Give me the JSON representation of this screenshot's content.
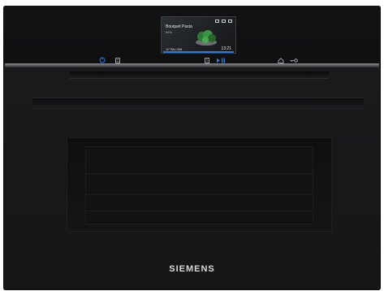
{
  "image": {
    "subject": "built-in compact oven"
  },
  "display": {
    "title": "Bouquet Pasta",
    "subtitle": "96%",
    "left_text": "11°/Mo.368",
    "time": "13:21"
  },
  "brand": {
    "text": "SIEMENS"
  },
  "colors": {
    "body": "#161617",
    "trim": "#7a7c7f",
    "accent": "#2a7be0",
    "logo": "#d8d8d8"
  },
  "icons": {
    "power": "power-icon",
    "menu": "menu-icon",
    "door": "door-icon",
    "play": "play-pause-icon",
    "home": "home-icon",
    "key": "key-icon"
  }
}
